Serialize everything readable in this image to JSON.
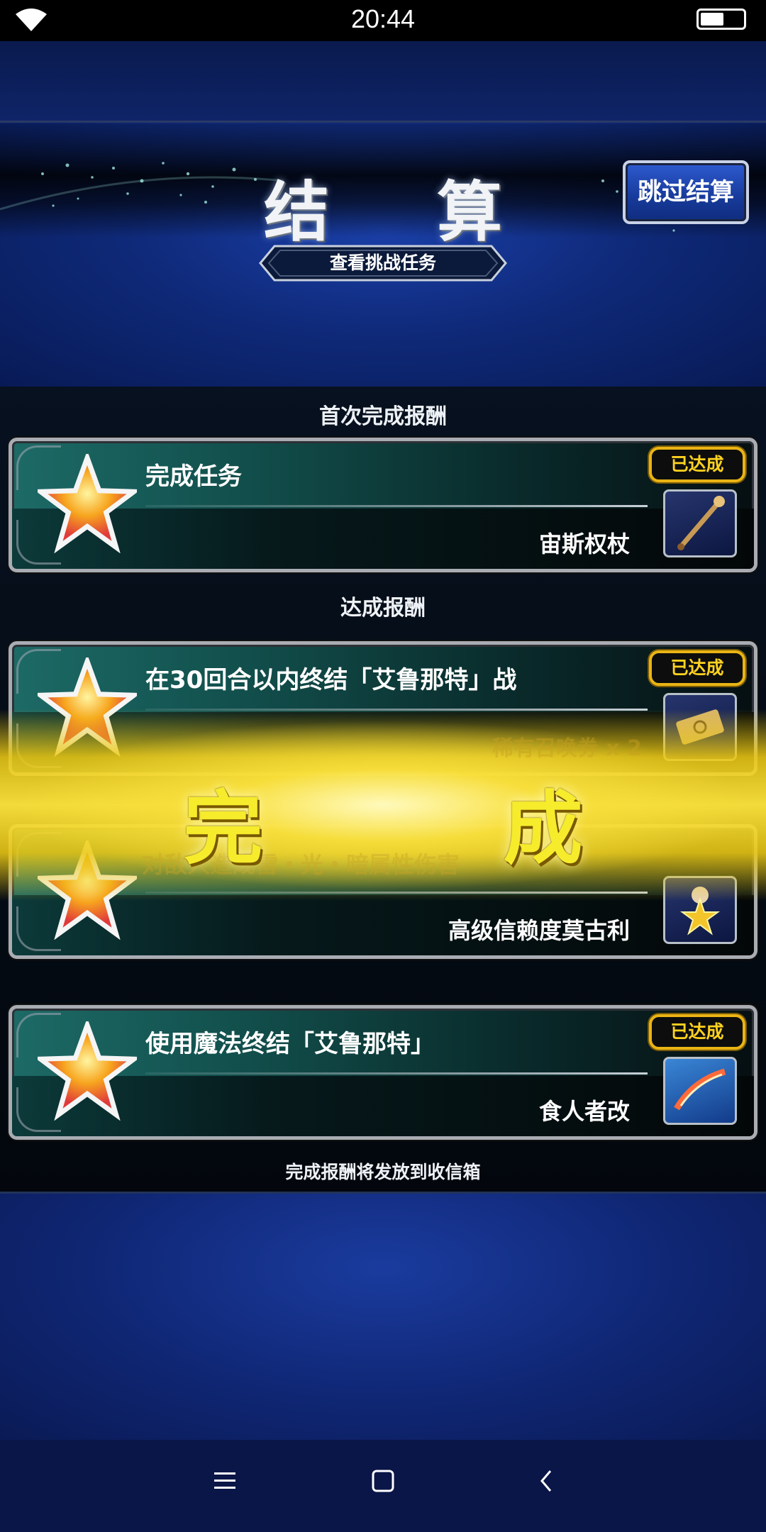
{
  "status_bar": {
    "time": "20:44"
  },
  "header": {
    "title": "结 算",
    "skip_button": "跳过结算",
    "challenge_button": "查看挑战任务"
  },
  "sections": {
    "first_clear": "首次完成报酬",
    "achievement": "达成报酬",
    "footer_note": "完成报酬将发放到收信箱"
  },
  "cards": [
    {
      "task": "完成任务",
      "reward": "宙斯权杖",
      "badge": "已达成",
      "icon": "scepter-icon"
    },
    {
      "task": "在30回合以内终结「艾鲁那特」战",
      "reward": "稀有召唤券 x 2",
      "badge": "已达成",
      "icon": "ticket-icon"
    },
    {
      "task": "对敌人造成雷・光・暗属性伤害",
      "reward": "高级信赖度莫古利",
      "badge": "已达成",
      "icon": "moogle-star-icon"
    },
    {
      "task": "使用魔法终结「艾鲁那特」",
      "reward": "食人者改",
      "badge": "已达成",
      "icon": "sword-slash-icon"
    }
  ],
  "overlay": {
    "text": "完 成"
  },
  "colors": {
    "badge_gold": "#e9b414",
    "burst_yellow": "#f6ec2c",
    "panel_teal": "#1d6a66"
  }
}
